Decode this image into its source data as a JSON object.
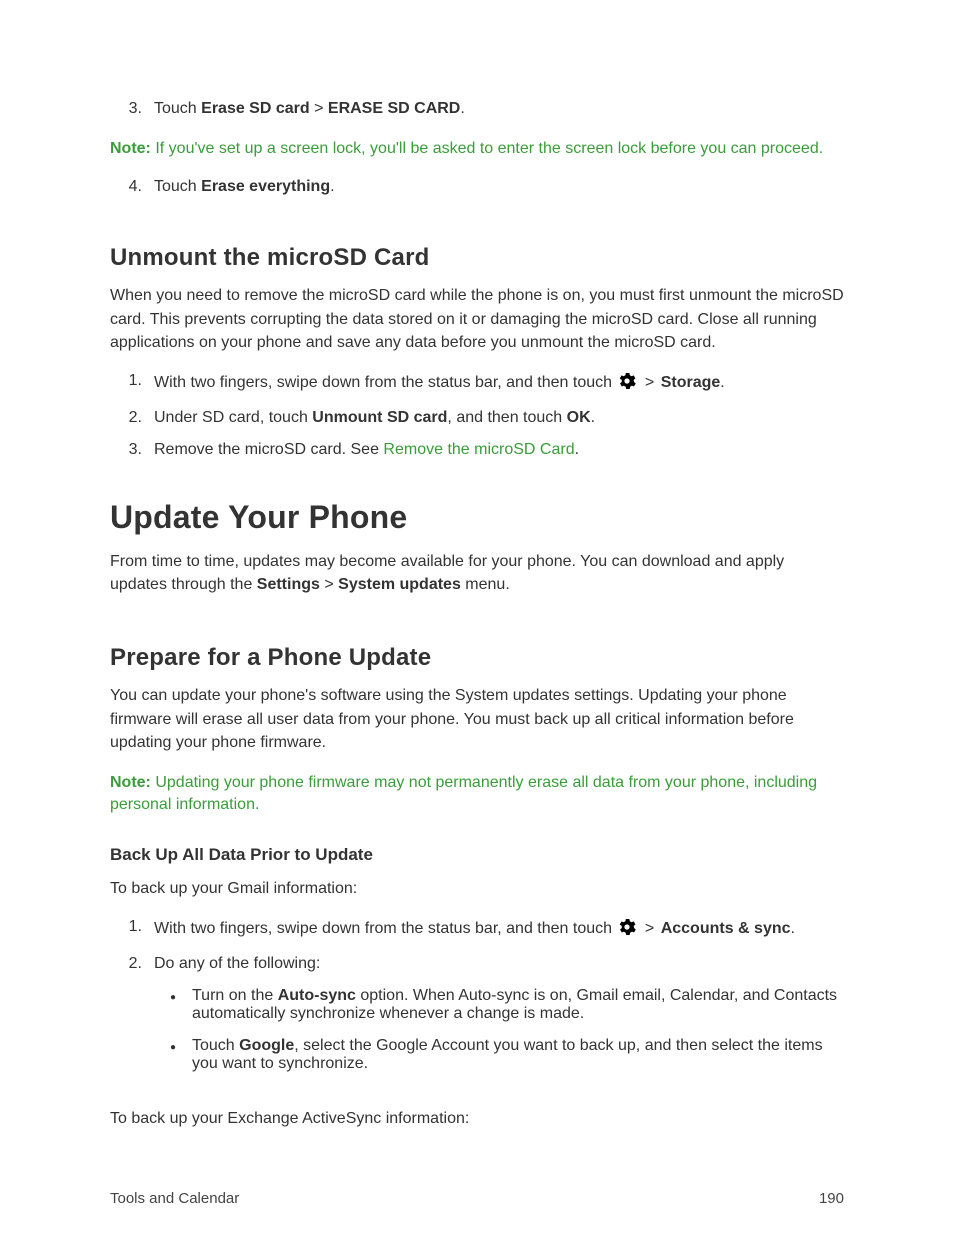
{
  "step3": {
    "num": "3.",
    "t1": "Touch ",
    "b1": "Erase SD card",
    "gt": " > ",
    "b2": "ERASE SD CARD",
    "t2": "."
  },
  "note1": {
    "label": "Note:",
    "text": " If you've set up a screen lock, you'll be asked to enter the screen lock before you can proceed."
  },
  "step4": {
    "num": "4.",
    "t1": "Touch ",
    "b1": "Erase everything",
    "t2": "."
  },
  "h2_unmount": "Unmount the microSD Card",
  "p_unmount": "When you need to remove the microSD card while the phone is on, you must first unmount the microSD card. This prevents corrupting the data stored on it or damaging the microSD card. Close all running applications on your phone and save any data before you unmount the microSD card.",
  "u1": {
    "num": "1.",
    "t1": "With two fingers, swipe down from the status bar, and then touch ",
    "gt": " > ",
    "b1": "Storage",
    "t2": "."
  },
  "u2": {
    "num": "2.",
    "t1": "Under SD card, touch ",
    "b1": "Unmount SD card",
    "t2": ", and then touch ",
    "b2": "OK",
    "t3": "."
  },
  "u3": {
    "num": "3.",
    "t1": "Remove the microSD card. See ",
    "link": "Remove the microSD Card",
    "t2": "."
  },
  "h1_update": "Update Your Phone",
  "p_update": {
    "t1": "From time to time, updates may become available for your phone. You can download and apply updates through the ",
    "b1": "Settings",
    "gt": " > ",
    "b2": "System updates",
    "t2": " menu."
  },
  "h2_prepare": "Prepare for a Phone Update",
  "p_prepare": "You can update your phone's software using the System updates settings. Updating your phone firmware will erase all user data from your phone. You must back up all critical information before updating your phone firmware.",
  "note2": {
    "label": "Note:",
    "text": " Updating your phone firmware may not permanently erase all data from your phone, including personal information."
  },
  "h3_backup": "Back Up All Data Prior to Update",
  "p_gmail": "To back up your Gmail information:",
  "b1": {
    "num": "1.",
    "t1": "With two fingers, swipe down from the status bar, and then touch ",
    "gt": " > ",
    "b1": "Accounts & sync",
    "t2": "."
  },
  "b2": {
    "num": "2.",
    "t1": "Do any of the following:"
  },
  "sub1": {
    "bullet": "●",
    "t1": "Turn on the ",
    "b1": "Auto-sync",
    "t2": " option. When Auto-sync is on, Gmail email, Calendar, and Contacts automatically synchronize whenever a change is made."
  },
  "sub2": {
    "bullet": "●",
    "t1": "Touch ",
    "b1": "Google",
    "t2": ", select the Google Account you want to back up, and then select the items you want to synchronize."
  },
  "p_exchange": "To back up your Exchange ActiveSync information:",
  "footer": {
    "section": "Tools and Calendar",
    "page": "190"
  }
}
